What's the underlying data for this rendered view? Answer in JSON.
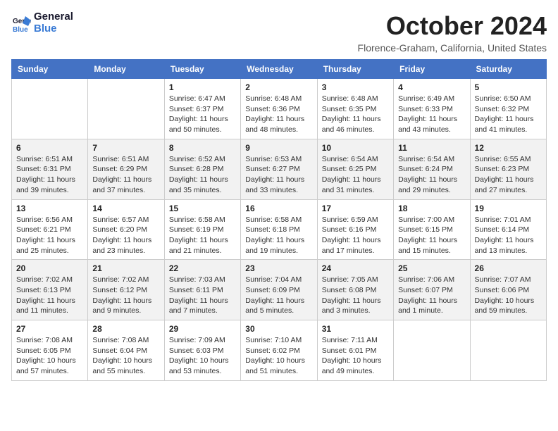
{
  "logo": {
    "line1": "General",
    "line2": "Blue"
  },
  "header": {
    "title": "October 2024",
    "subtitle": "Florence-Graham, California, United States"
  },
  "weekdays": [
    "Sunday",
    "Monday",
    "Tuesday",
    "Wednesday",
    "Thursday",
    "Friday",
    "Saturday"
  ],
  "weeks": [
    [
      {
        "day": "",
        "info": ""
      },
      {
        "day": "",
        "info": ""
      },
      {
        "day": "1",
        "info": "Sunrise: 6:47 AM\nSunset: 6:37 PM\nDaylight: 11 hours and 50 minutes."
      },
      {
        "day": "2",
        "info": "Sunrise: 6:48 AM\nSunset: 6:36 PM\nDaylight: 11 hours and 48 minutes."
      },
      {
        "day": "3",
        "info": "Sunrise: 6:48 AM\nSunset: 6:35 PM\nDaylight: 11 hours and 46 minutes."
      },
      {
        "day": "4",
        "info": "Sunrise: 6:49 AM\nSunset: 6:33 PM\nDaylight: 11 hours and 43 minutes."
      },
      {
        "day": "5",
        "info": "Sunrise: 6:50 AM\nSunset: 6:32 PM\nDaylight: 11 hours and 41 minutes."
      }
    ],
    [
      {
        "day": "6",
        "info": "Sunrise: 6:51 AM\nSunset: 6:31 PM\nDaylight: 11 hours and 39 minutes."
      },
      {
        "day": "7",
        "info": "Sunrise: 6:51 AM\nSunset: 6:29 PM\nDaylight: 11 hours and 37 minutes."
      },
      {
        "day": "8",
        "info": "Sunrise: 6:52 AM\nSunset: 6:28 PM\nDaylight: 11 hours and 35 minutes."
      },
      {
        "day": "9",
        "info": "Sunrise: 6:53 AM\nSunset: 6:27 PM\nDaylight: 11 hours and 33 minutes."
      },
      {
        "day": "10",
        "info": "Sunrise: 6:54 AM\nSunset: 6:25 PM\nDaylight: 11 hours and 31 minutes."
      },
      {
        "day": "11",
        "info": "Sunrise: 6:54 AM\nSunset: 6:24 PM\nDaylight: 11 hours and 29 minutes."
      },
      {
        "day": "12",
        "info": "Sunrise: 6:55 AM\nSunset: 6:23 PM\nDaylight: 11 hours and 27 minutes."
      }
    ],
    [
      {
        "day": "13",
        "info": "Sunrise: 6:56 AM\nSunset: 6:21 PM\nDaylight: 11 hours and 25 minutes."
      },
      {
        "day": "14",
        "info": "Sunrise: 6:57 AM\nSunset: 6:20 PM\nDaylight: 11 hours and 23 minutes."
      },
      {
        "day": "15",
        "info": "Sunrise: 6:58 AM\nSunset: 6:19 PM\nDaylight: 11 hours and 21 minutes."
      },
      {
        "day": "16",
        "info": "Sunrise: 6:58 AM\nSunset: 6:18 PM\nDaylight: 11 hours and 19 minutes."
      },
      {
        "day": "17",
        "info": "Sunrise: 6:59 AM\nSunset: 6:16 PM\nDaylight: 11 hours and 17 minutes."
      },
      {
        "day": "18",
        "info": "Sunrise: 7:00 AM\nSunset: 6:15 PM\nDaylight: 11 hours and 15 minutes."
      },
      {
        "day": "19",
        "info": "Sunrise: 7:01 AM\nSunset: 6:14 PM\nDaylight: 11 hours and 13 minutes."
      }
    ],
    [
      {
        "day": "20",
        "info": "Sunrise: 7:02 AM\nSunset: 6:13 PM\nDaylight: 11 hours and 11 minutes."
      },
      {
        "day": "21",
        "info": "Sunrise: 7:02 AM\nSunset: 6:12 PM\nDaylight: 11 hours and 9 minutes."
      },
      {
        "day": "22",
        "info": "Sunrise: 7:03 AM\nSunset: 6:11 PM\nDaylight: 11 hours and 7 minutes."
      },
      {
        "day": "23",
        "info": "Sunrise: 7:04 AM\nSunset: 6:09 PM\nDaylight: 11 hours and 5 minutes."
      },
      {
        "day": "24",
        "info": "Sunrise: 7:05 AM\nSunset: 6:08 PM\nDaylight: 11 hours and 3 minutes."
      },
      {
        "day": "25",
        "info": "Sunrise: 7:06 AM\nSunset: 6:07 PM\nDaylight: 11 hours and 1 minute."
      },
      {
        "day": "26",
        "info": "Sunrise: 7:07 AM\nSunset: 6:06 PM\nDaylight: 10 hours and 59 minutes."
      }
    ],
    [
      {
        "day": "27",
        "info": "Sunrise: 7:08 AM\nSunset: 6:05 PM\nDaylight: 10 hours and 57 minutes."
      },
      {
        "day": "28",
        "info": "Sunrise: 7:08 AM\nSunset: 6:04 PM\nDaylight: 10 hours and 55 minutes."
      },
      {
        "day": "29",
        "info": "Sunrise: 7:09 AM\nSunset: 6:03 PM\nDaylight: 10 hours and 53 minutes."
      },
      {
        "day": "30",
        "info": "Sunrise: 7:10 AM\nSunset: 6:02 PM\nDaylight: 10 hours and 51 minutes."
      },
      {
        "day": "31",
        "info": "Sunrise: 7:11 AM\nSunset: 6:01 PM\nDaylight: 10 hours and 49 minutes."
      },
      {
        "day": "",
        "info": ""
      },
      {
        "day": "",
        "info": ""
      }
    ]
  ]
}
